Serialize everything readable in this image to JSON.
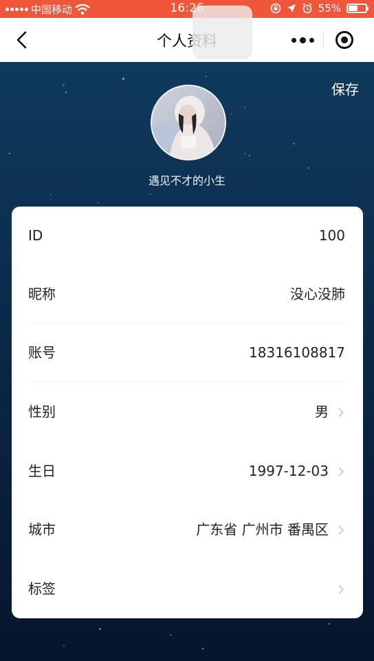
{
  "status_bar": {
    "carrier": "中国移动",
    "time": "16:26",
    "battery_percent": "55%",
    "battery_level": 0.55
  },
  "nav": {
    "title": "个人资料"
  },
  "profile": {
    "save_label": "保存",
    "display_name": "遇见不才的小生"
  },
  "fields": [
    {
      "label": "ID",
      "value": "100"
    },
    {
      "label": "昵称",
      "value": "没心没肺"
    },
    {
      "label": "账号",
      "value": "18316108817"
    },
    {
      "label": "性别",
      "value": "男"
    },
    {
      "label": "生日",
      "value": "1997-12-03"
    },
    {
      "label": "城市",
      "value": "广东省 广州市 番禺区"
    },
    {
      "label": "标签",
      "value": ""
    }
  ],
  "colors": {
    "status_bar": "#f0573a",
    "card_bg": "#ffffff",
    "hero_top": "#0f3a5c",
    "hero_bottom": "#07152c"
  }
}
